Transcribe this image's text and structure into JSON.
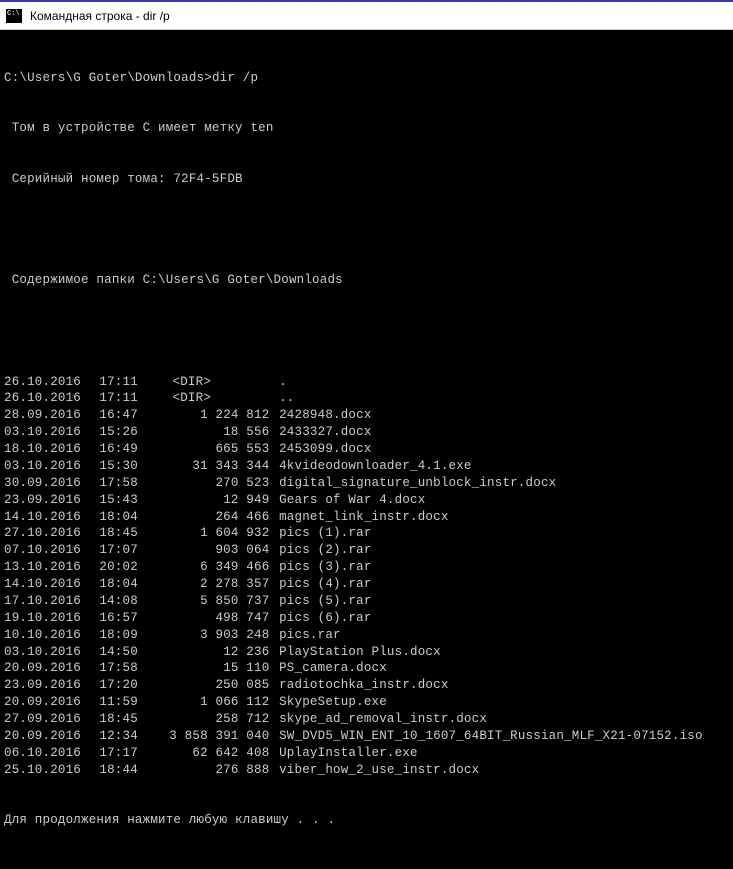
{
  "titlebar": {
    "text": "Командная строка - dir  /p"
  },
  "prompt": {
    "path": "C:\\Users\\G Goter\\Downloads>",
    "command": "dir /p"
  },
  "volume": {
    "line1": " Том в устройстве C имеет метку ten",
    "line2": " Серийный номер тома: 72F4-5FDB"
  },
  "header": {
    "line": " Содержимое папки C:\\Users\\G Goter\\Downloads"
  },
  "entries": [
    {
      "date": "26.10.2016",
      "time": "17:11",
      "dir": true,
      "size": "",
      "name": "."
    },
    {
      "date": "26.10.2016",
      "time": "17:11",
      "dir": true,
      "size": "",
      "name": ".."
    },
    {
      "date": "28.09.2016",
      "time": "16:47",
      "dir": false,
      "size": "1 224 812",
      "name": "2428948.docx"
    },
    {
      "date": "03.10.2016",
      "time": "15:26",
      "dir": false,
      "size": "18 556",
      "name": "2433327.docx"
    },
    {
      "date": "18.10.2016",
      "time": "16:49",
      "dir": false,
      "size": "665 553",
      "name": "2453099.docx"
    },
    {
      "date": "03.10.2016",
      "time": "15:30",
      "dir": false,
      "size": "31 343 344",
      "name": "4kvideodownloader_4.1.exe"
    },
    {
      "date": "30.09.2016",
      "time": "17:58",
      "dir": false,
      "size": "270 523",
      "name": "digital_signature_unblock_instr.docx"
    },
    {
      "date": "23.09.2016",
      "time": "15:43",
      "dir": false,
      "size": "12 949",
      "name": "Gears of War 4.docx"
    },
    {
      "date": "14.10.2016",
      "time": "18:04",
      "dir": false,
      "size": "264 466",
      "name": "magnet_link_instr.docx"
    },
    {
      "date": "27.10.2016",
      "time": "18:45",
      "dir": false,
      "size": "1 604 932",
      "name": "pics (1).rar"
    },
    {
      "date": "07.10.2016",
      "time": "17:07",
      "dir": false,
      "size": "903 064",
      "name": "pics (2).rar"
    },
    {
      "date": "13.10.2016",
      "time": "20:02",
      "dir": false,
      "size": "6 349 466",
      "name": "pics (3).rar"
    },
    {
      "date": "14.10.2016",
      "time": "18:04",
      "dir": false,
      "size": "2 278 357",
      "name": "pics (4).rar"
    },
    {
      "date": "17.10.2016",
      "time": "14:08",
      "dir": false,
      "size": "5 850 737",
      "name": "pics (5).rar"
    },
    {
      "date": "19.10.2016",
      "time": "16:57",
      "dir": false,
      "size": "498 747",
      "name": "pics (6).rar"
    },
    {
      "date": "10.10.2016",
      "time": "18:09",
      "dir": false,
      "size": "3 903 248",
      "name": "pics.rar"
    },
    {
      "date": "03.10.2016",
      "time": "14:50",
      "dir": false,
      "size": "12 236",
      "name": "PlayStation Plus.docx"
    },
    {
      "date": "20.09.2016",
      "time": "17:58",
      "dir": false,
      "size": "15 110",
      "name": "PS_camera.docx"
    },
    {
      "date": "23.09.2016",
      "time": "17:20",
      "dir": false,
      "size": "250 085",
      "name": "radiotochka_instr.docx"
    },
    {
      "date": "20.09.2016",
      "time": "11:59",
      "dir": false,
      "size": "1 066 112",
      "name": "SkypeSetup.exe"
    },
    {
      "date": "27.09.2016",
      "time": "18:45",
      "dir": false,
      "size": "258 712",
      "name": "skype_ad_removal_instr.docx"
    },
    {
      "date": "20.09.2016",
      "time": "12:34",
      "dir": false,
      "size": "3 858 391 040",
      "name": "SW_DVD5_WIN_ENT_10_1607_64BIT_Russian_MLF_X21-07152.iso"
    },
    {
      "date": "06.10.2016",
      "time": "17:17",
      "dir": false,
      "size": "62 642 408",
      "name": "UplayInstaller.exe"
    },
    {
      "date": "25.10.2016",
      "time": "18:44",
      "dir": false,
      "size": "276 888",
      "name": "viber_how_2_use_instr.docx"
    }
  ],
  "footer": {
    "line": "Для продолжения нажмите любую клавишу . . ."
  },
  "dir_marker": "<DIR>"
}
